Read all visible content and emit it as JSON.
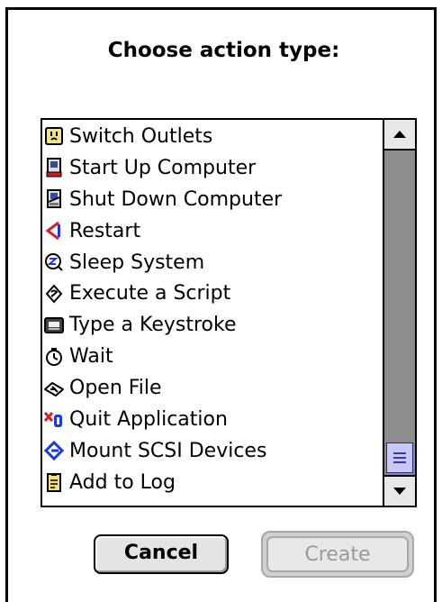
{
  "dialog": {
    "title": "Choose action type:",
    "items": [
      {
        "label": "Switch Outlets",
        "icon": "outlet-icon"
      },
      {
        "label": "Start Up Computer",
        "icon": "computer-startup-icon"
      },
      {
        "label": "Shut Down Computer",
        "icon": "computer-shutdown-icon"
      },
      {
        "label": "Restart",
        "icon": "restart-icon"
      },
      {
        "label": "Sleep System",
        "icon": "sleep-icon"
      },
      {
        "label": "Execute a Script",
        "icon": "script-icon"
      },
      {
        "label": "Type a Keystroke",
        "icon": "keyboard-icon"
      },
      {
        "label": "Wait",
        "icon": "stopwatch-icon"
      },
      {
        "label": "Open File",
        "icon": "open-file-icon"
      },
      {
        "label": "Quit Application",
        "icon": "quit-application-icon"
      },
      {
        "label": "Mount SCSI Devices",
        "icon": "scsi-icon"
      },
      {
        "label": "Add to Log",
        "icon": "log-icon"
      }
    ],
    "cancel_label": "Cancel",
    "create_label": "Create"
  },
  "colors": {
    "scrollbar_track": "#8d8d8d",
    "scrollbar_thumb": "#c8c8f8",
    "restart_red": "#d81e2a",
    "scsi_blue": "#1a3ad8",
    "disabled_text": "#9a9a9a"
  }
}
